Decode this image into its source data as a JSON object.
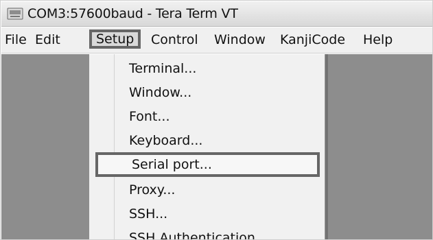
{
  "window": {
    "title": "COM3:57600baud - Tera Term VT",
    "app_icon": "tera-term-icon"
  },
  "menu": {
    "items": [
      {
        "label": "File"
      },
      {
        "label": "Edit"
      },
      {
        "label": "Setup",
        "active": true
      },
      {
        "label": "Control"
      },
      {
        "label": "Window"
      },
      {
        "label": "KanjiCode"
      },
      {
        "label": "Help"
      }
    ]
  },
  "setup_menu": {
    "items": [
      {
        "label": "Terminal..."
      },
      {
        "label": "Window..."
      },
      {
        "label": "Font..."
      },
      {
        "label": "Keyboard..."
      },
      {
        "label": "Serial port...",
        "highlighted": true
      },
      {
        "label": "Proxy..."
      },
      {
        "label": "SSH..."
      },
      {
        "label": "SSH Authentication..."
      }
    ]
  },
  "colors": {
    "terminal_background": "#8d8d8d",
    "menu_background": "#f0f0f0",
    "highlight_border": "#666666"
  }
}
